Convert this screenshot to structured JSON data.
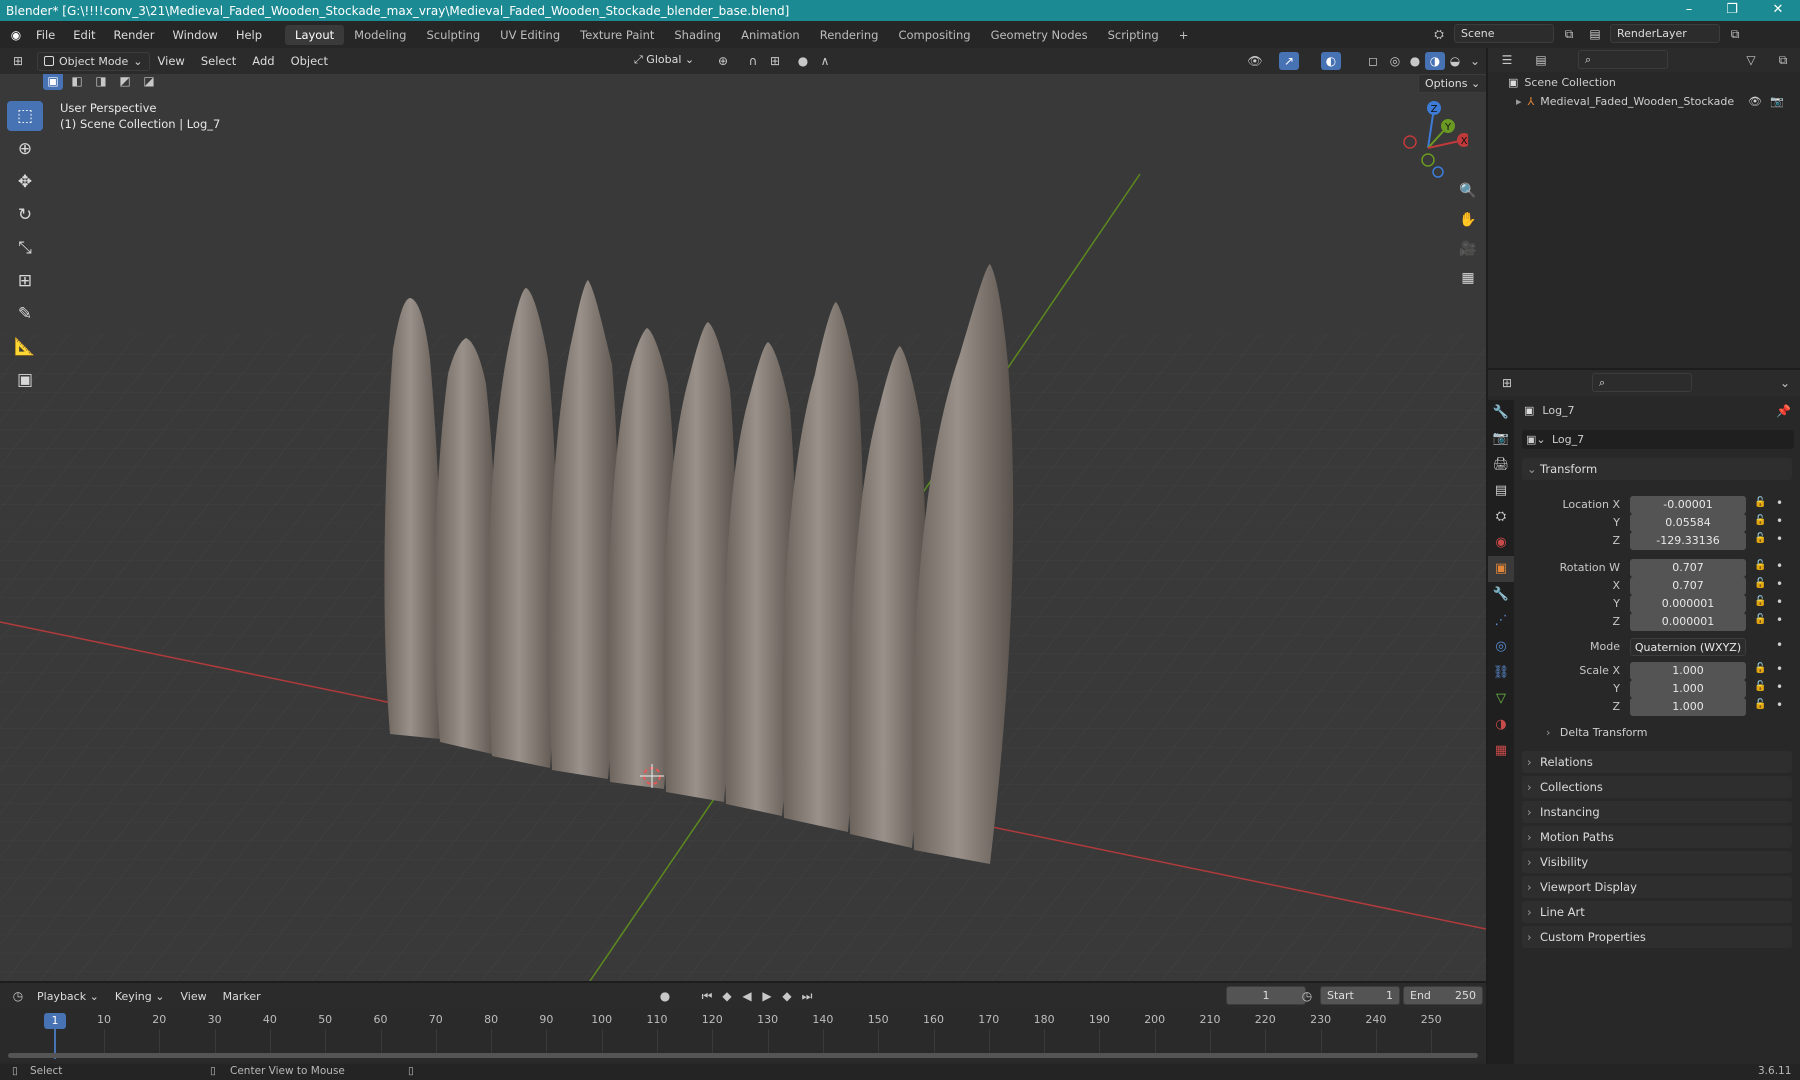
{
  "window": {
    "title": "Blender* [G:\\!!!!conv_3\\21\\Medieval_Faded_Wooden_Stockade_max_vray\\Medieval_Faded_Wooden_Stockade_blender_base.blend]",
    "minimize": "–",
    "maximize": "❐",
    "close": "✕"
  },
  "menubar": {
    "items": [
      "File",
      "Edit",
      "Render",
      "Window",
      "Help"
    ],
    "workspaces": [
      "Layout",
      "Modeling",
      "Sculpting",
      "UV Editing",
      "Texture Paint",
      "Shading",
      "Animation",
      "Rendering",
      "Compositing",
      "Geometry Nodes",
      "Scripting"
    ],
    "add_workspace": "+",
    "scene": "Scene",
    "view_layer": "RenderLayer"
  },
  "viewport_header": {
    "mode": "Object Mode",
    "menus": [
      "View",
      "Select",
      "Add",
      "Object"
    ],
    "orientation": "Global",
    "options": "Options"
  },
  "viewport": {
    "perspective": "User Perspective",
    "collection_info": "(1) Scene Collection | Log_7",
    "gizmo_labels": {
      "z": "Z",
      "y": "Y",
      "x": "X"
    }
  },
  "tools": [
    "select-box",
    "cursor",
    "move",
    "rotate",
    "scale",
    "transform",
    "annotate",
    "measure",
    "add-cube"
  ],
  "outliner": {
    "scene_collection": "Scene Collection",
    "items": [
      {
        "name": "Medieval_Faded_Wooden_Stockade"
      }
    ]
  },
  "properties": {
    "object_name": "Log_7",
    "data_name": "Log_7",
    "transform_title": "Transform",
    "location": {
      "label": "Location X",
      "x": "-0.00001",
      "y": "0.05584",
      "z": "-129.33136"
    },
    "rotation": {
      "label": "Rotation W",
      "w": "0.707",
      "x": "0.707",
      "y": "0.000001",
      "z": "0.000001"
    },
    "mode": {
      "label": "Mode",
      "value": "Quaternion (WXYZ)"
    },
    "scale": {
      "label": "Scale X",
      "x": "1.000",
      "y": "1.000",
      "z": "1.000"
    },
    "axis_labels": {
      "x": "X",
      "y": "Y",
      "z": "Z"
    },
    "delta_transform": "Delta Transform",
    "panels": [
      "Relations",
      "Collections",
      "Instancing",
      "Motion Paths",
      "Visibility",
      "Viewport Display",
      "Line Art",
      "Custom Properties"
    ]
  },
  "timeline": {
    "menus": [
      "Playback",
      "Keying",
      "View",
      "Marker"
    ],
    "current_frame": "1",
    "start_label": "Start",
    "start": "1",
    "end_label": "End",
    "end": "250",
    "ruler": [
      "10",
      "20",
      "30",
      "40",
      "50",
      "60",
      "70",
      "80",
      "90",
      "100",
      "110",
      "120",
      "130",
      "140",
      "150",
      "160",
      "170",
      "180",
      "190",
      "200",
      "210",
      "220",
      "230",
      "240",
      "250"
    ]
  },
  "statusbar": {
    "left": "Select",
    "middle": "Center View to Mouse",
    "version": "3.6.11"
  },
  "colors": {
    "titlebar": "#1c8a93",
    "accent": "#4772b3",
    "x_axis": "#c0393b",
    "y_axis": "#6a9a22",
    "z_axis": "#3d7bd6"
  }
}
